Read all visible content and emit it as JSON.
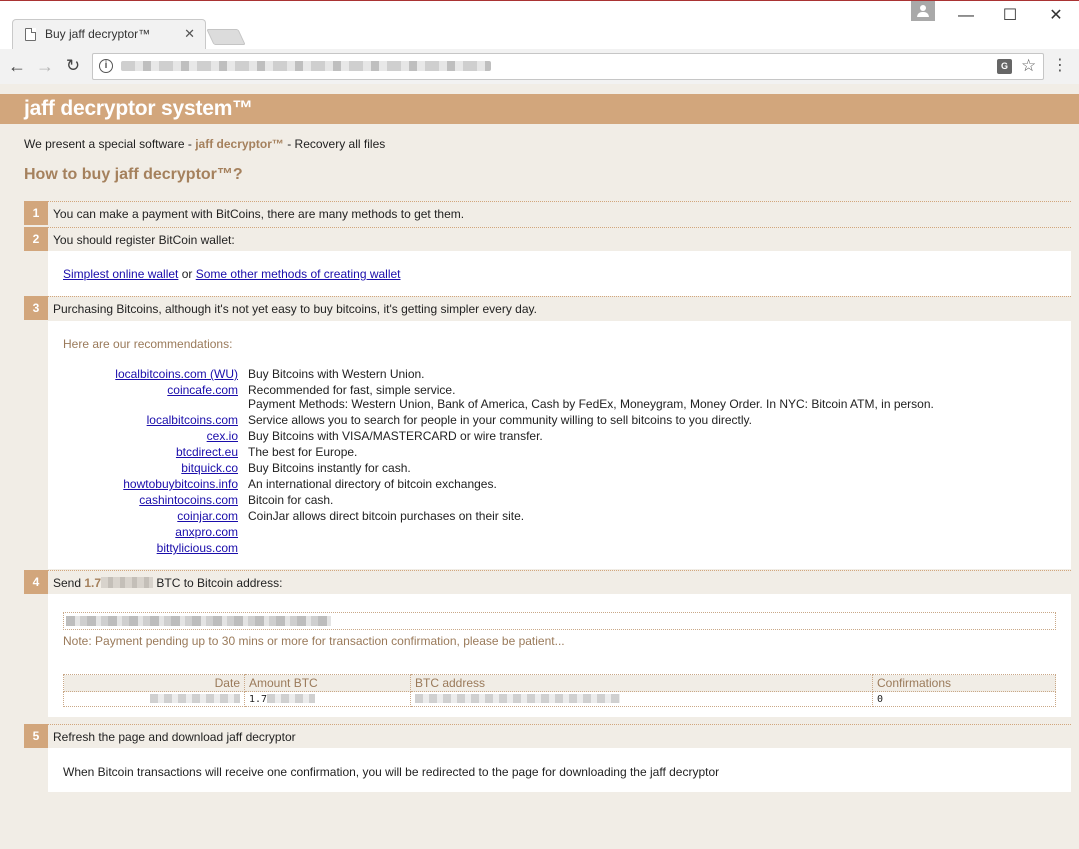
{
  "browser": {
    "tab_title": "Buy jaff decryptor™",
    "tab_close": "✕",
    "win_min": "—",
    "win_max": "☐",
    "win_close": "✕",
    "back": "←",
    "forward": "→",
    "reload": "↻",
    "info": "i",
    "translate": "G",
    "star": "☆",
    "menu": "⋮"
  },
  "page": {
    "banner_title": "jaff decryptor system™",
    "intro_before": "We present a special software - ",
    "intro_brand": "jaff decryptor™",
    "intro_after": " - Recovery all files",
    "howto_title": "How to buy jaff decryptor™?"
  },
  "steps": [
    {
      "num": "1",
      "text": "You can make a payment with BitCoins, there are many methods to get them."
    },
    {
      "num": "2",
      "text": "You should register BitCoin wallet:"
    },
    {
      "num": "3",
      "text": "Purchasing Bitcoins, although it's not yet easy to buy bitcoins, it's getting simpler every day."
    },
    {
      "num": "4",
      "text_before": "Send ",
      "amount": "1.7",
      "text_after": " BTC to Bitcoin address:"
    },
    {
      "num": "5",
      "text": "Refresh the page and download jaff decryptor"
    }
  ],
  "wallet": {
    "link1": "Simplest online wallet",
    "or": " or ",
    "link2": "Some other methods of creating wallet"
  },
  "recommendations": {
    "label": "Here are our recommendations:",
    "items": [
      {
        "site": "localbitcoins.com (WU)",
        "desc": "Buy Bitcoins with Western Union."
      },
      {
        "site": "coincafe.com",
        "desc": "Recommended for fast, simple service.",
        "extra": "Payment Methods: Western Union, Bank of America, Cash by FedEx, Moneygram, Money Order. In NYC: Bitcoin ATM, in person."
      },
      {
        "site": "localbitcoins.com",
        "desc": "Service allows you to search for people in your community willing to sell bitcoins to you directly."
      },
      {
        "site": "cex.io",
        "desc": "Buy Bitcoins with VISA/MASTERCARD or wire transfer."
      },
      {
        "site": "btcdirect.eu",
        "desc": "The best for Europe."
      },
      {
        "site": "bitquick.co",
        "desc": "Buy Bitcoins instantly for cash."
      },
      {
        "site": "howtobuybitcoins.info",
        "desc": "An international directory of bitcoin exchanges."
      },
      {
        "site": "cashintocoins.com",
        "desc": "Bitcoin for cash."
      },
      {
        "site": "coinjar.com",
        "desc": "CoinJar allows direct bitcoin purchases on their site."
      },
      {
        "site": "anxpro.com",
        "desc": ""
      },
      {
        "site": "bittylicious.com",
        "desc": ""
      }
    ]
  },
  "payment": {
    "note": "Note: Payment pending up to 30 mins or more for transaction confirmation, please be patient...",
    "table_headers": {
      "date": "Date",
      "amount": "Amount BTC",
      "address": "BTC address",
      "confirmations": "Confirmations"
    },
    "row": {
      "amount": "1.7",
      "confirmations": "0"
    }
  },
  "final_text": "When Bitcoin transactions will receive one confirmation, you will be redirected to the page for downloading the jaff decryptor"
}
